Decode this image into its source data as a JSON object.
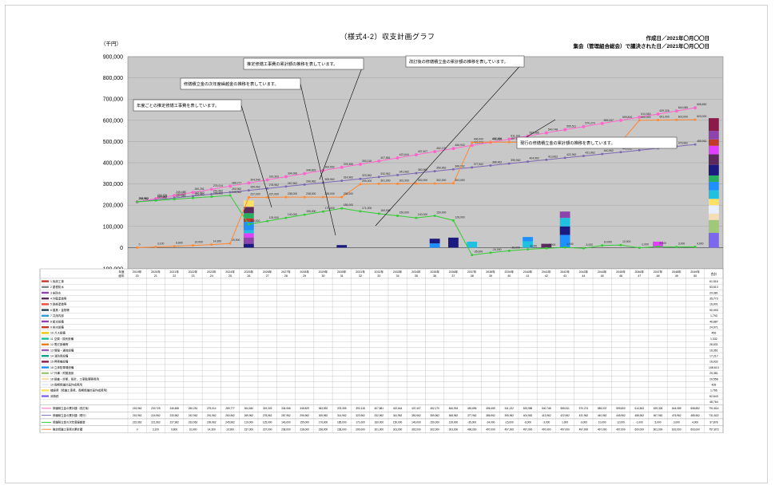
{
  "header": {
    "title": "（様式4-2）収支計画グラフ",
    "created": "作成日／2021年〇月〇〇日",
    "approved": "集会（管理組合総会）で議決された日／2021年〇月〇〇日",
    "unit": "（千円）"
  },
  "chart_data": {
    "type": "bar",
    "title": "（様式4-2）収支計画グラフ",
    "ylabel": "（千円）",
    "ylim": [
      -100000,
      900000
    ],
    "yticks": [
      "900,000",
      "800,000",
      "700,000",
      "600,000",
      "500,000",
      "400,000",
      "300,000",
      "200,000",
      "100,000",
      "0",
      "-100,000"
    ],
    "grid": true,
    "categories": [
      "1",
      "2",
      "3",
      "4",
      "5",
      "6",
      "7",
      "8",
      "9",
      "10",
      "11",
      "12",
      "13",
      "14",
      "15",
      "16",
      "17",
      "18",
      "19",
      "20",
      "21",
      "22",
      "23",
      "24",
      "25",
      "26",
      "27",
      "28",
      "29",
      "30",
      "31"
    ],
    "row_header": [
      "年度",
      "経年"
    ],
    "year_labels": [
      "2019年",
      "2020年",
      "2021年",
      "2022年",
      "2023年",
      "2024年",
      "2025年",
      "2026年",
      "2027年",
      "2028年",
      "2029年",
      "2030年",
      "2031年",
      "2032年",
      "2033年",
      "2034年",
      "2035年",
      "2036年",
      "2037年",
      "2038年",
      "2039年",
      "2040年",
      "2041年",
      "2042年",
      "2043年",
      "2044年",
      "2045年",
      "2046年",
      "2047年",
      "2048年",
      "2049年"
    ],
    "age_labels": [
      "20",
      "21",
      "22",
      "23",
      "24",
      "25",
      "26",
      "27",
      "28",
      "29",
      "30",
      "31",
      "32",
      "33",
      "34",
      "35",
      "36",
      "37",
      "38",
      "39",
      "40",
      "41",
      "42",
      "43",
      "44",
      "45",
      "46",
      "47",
      "48",
      "49",
      "50"
    ],
    "total_label": "合計",
    "series": [
      {
        "name": "改訂後の修繕積立金の累計額",
        "color": "#ff66cc",
        "values": [
          215962,
          230725,
          245488,
          260251,
          275014,
          289777,
          304540,
          319303,
          334066,
          348829,
          363592,
          378355,
          393118,
          407881,
          422644,
          437407,
          452170,
          466933,
          481696,
          496459,
          511222,
          525985,
          540748,
          555511,
          570274,
          585037,
          599800,
          614563,
          629326,
          644089,
          658852
        ]
      },
      {
        "name": "現行の修繕積立金の累計額",
        "color": "#7b68b0",
        "values": [
          215962,
          224962,
          233962,
          242962,
          251962,
          260962,
          269962,
          278962,
          287962,
          296962,
          305962,
          314962,
          323962,
          332962,
          341962,
          350962,
          359962,
          368962,
          377962,
          386962,
          395962,
          404962,
          413962,
          422962,
          431962,
          440962,
          449962,
          458962,
          467962,
          476962,
          485962
        ]
      },
      {
        "name": "修繕積立金の次年度繰越金の推移",
        "color": "#33cc33",
        "values": [
          215962,
          221962,
          227962,
          233962,
          239962,
          245962,
          110000,
          125000,
          140000,
          155000,
          170000,
          185000,
          171000,
          160000,
          150000,
          140000,
          150000,
          128000,
          -35000,
          -24000,
          -15000,
          -8000,
          -3000,
          1000,
          -3000,
          10000,
          12000,
          -1000,
          5000,
          3000,
          4000
        ]
      },
      {
        "name": "推定修繕工事費の累計額",
        "color": "#ff8833",
        "values": [
          0,
          3100,
          6800,
          10000,
          14300,
          19900,
          237000,
          237000,
          238000,
          238000,
          238000,
          238000,
          299000,
          301000,
          301000,
          302000,
          302000,
          303000,
          496000,
          497000,
          497000,
          497000,
          497000,
          497000,
          497000,
          497000,
          497000,
          600000,
          601000,
          602000,
          603000
        ]
      },
      {
        "name": "年度ごとの推定修繕工事費",
        "color": "#1f6fcc",
        "values": [
          0,
          0,
          0,
          0,
          0,
          0,
          222000,
          0,
          0,
          0,
          0,
          0,
          42000,
          47000,
          0,
          0,
          50000,
          0,
          170000,
          0,
          0,
          0,
          0,
          28000,
          0,
          0,
          0,
          75000,
          0,
          0,
          0
        ]
      }
    ],
    "bar_stacks": [
      [],
      [],
      [],
      [],
      [],
      [],
      [
        {
          "v": 18000,
          "c": "#1a1a80"
        },
        {
          "v": 30000,
          "c": "#8e44ad"
        },
        {
          "v": 20000,
          "c": "#e040fb"
        },
        {
          "v": 14000,
          "c": "#20c0e0"
        },
        {
          "v": 40000,
          "c": "#1e90ff"
        },
        {
          "v": 16000,
          "c": "#c0392b"
        },
        {
          "v": 24000,
          "c": "#27ae60"
        },
        {
          "v": 30000,
          "c": "#5c2a5c"
        },
        {
          "v": 30000,
          "c": "#ffe066"
        }
      ],
      [],
      [],
      [],
      [],
      [
        {
          "v": 12000,
          "c": "#1a1a80"
        }
      ],
      [],
      [],
      [],
      [],
      [
        {
          "v": 20000,
          "c": "#1e90ff"
        },
        {
          "v": 22000,
          "c": "#1a1a80"
        }
      ],
      [
        {
          "v": 47000,
          "c": "#1a1a80"
        }
      ],
      [
        {
          "v": 28000,
          "c": "#20c0e0"
        }
      ],
      [],
      [],
      [
        {
          "v": 30000,
          "c": "#20c0e0"
        },
        {
          "v": 20000,
          "c": "#1e90ff"
        }
      ],
      [
        {
          "v": 18000,
          "c": "#5c2a5c"
        }
      ],
      [
        {
          "v": 60000,
          "c": "#1e90ff"
        },
        {
          "v": 40000,
          "c": "#1a1a80"
        },
        {
          "v": 40000,
          "c": "#20c0e0"
        },
        {
          "v": 30000,
          "c": "#8e44ad"
        }
      ],
      [],
      [],
      [],
      [],
      [
        {
          "v": 28000,
          "c": "#e040fb"
        }
      ],
      [],
      [],
      []
    ],
    "total_stack": [
      {
        "v": 70000,
        "c": "#7b68ee"
      },
      {
        "v": 60000,
        "c": "#a0c878"
      },
      {
        "v": 30000,
        "c": "#f5deb3"
      },
      {
        "v": 40000,
        "c": "#e8f0ff"
      },
      {
        "v": 30000,
        "c": "#ffe066"
      },
      {
        "v": 40000,
        "c": "#20c0e0"
      },
      {
        "v": 40000,
        "c": "#1e90ff"
      },
      {
        "v": 30000,
        "c": "#27ae60"
      },
      {
        "v": 50000,
        "c": "#1a1a80"
      },
      {
        "v": 50000,
        "c": "#5c2a5c"
      },
      {
        "v": 40000,
        "c": "#e040fb"
      },
      {
        "v": 30000,
        "c": "#c0392b"
      },
      {
        "v": 40000,
        "c": "#8e44ad"
      },
      {
        "v": 60000,
        "c": "#8b1a4a"
      }
    ],
    "annotations": [
      "推定修繕工事費の累計額の推移を表しています。",
      "改訂後の修繕積立金の累計額の推移を表しています。",
      "修繕積立金の次年度繰越金の推移を表しています。",
      "年度ごとの推定修繕工事費を表しています。",
      "現行の修繕積立金の累計額の推移を表しています。"
    ]
  },
  "table": {
    "rows": [
      {
        "label": "1 仮設工事",
        "color": "#c0392b",
        "total": "61,516"
      },
      {
        "label": "2 屋根防水",
        "color": "#7f8c8d",
        "total": "53,513"
      },
      {
        "label": "3 床防水",
        "color": "#8e44ad",
        "total": "29,381"
      },
      {
        "label": "4 外壁塗装等",
        "color": "#5c2a5c",
        "total": "35,773"
      },
      {
        "label": "5 鉄部塗装等",
        "color": "#e74c3c",
        "total": "16,901"
      },
      {
        "label": "6 建具・金物等",
        "color": "#2c3e50",
        "total": "90,993"
      },
      {
        "label": "7 共用内部",
        "color": "#3498db",
        "total": "1,793"
      },
      {
        "label": "8 給水設備",
        "color": "#8e44ad",
        "total": "46,887"
      },
      {
        "label": "9 排水設備",
        "color": "#c0392b",
        "total": "24,971"
      },
      {
        "label": "10 ガス設備",
        "color": "#f1c40f",
        "total": "456"
      },
      {
        "label": "11 空調・換気設備",
        "color": "#1abc9c",
        "total": "1,332"
      },
      {
        "label": "12 電灯設備等",
        "color": "#e67e22",
        "total": "28,631"
      },
      {
        "label": "13 情報・通信設備",
        "color": "#9b59b6",
        "total": "16,361"
      },
      {
        "label": "14 消防用設備",
        "color": "#16a085",
        "total": "17,217"
      },
      {
        "label": "15 昇降機設備",
        "color": "#8b1a4a",
        "total": "16,932"
      },
      {
        "label": "16 立体駐車場設備",
        "color": "#1e90ff",
        "total": "108,613"
      },
      {
        "label": "17 外構・附属施設",
        "color": "#a0c878",
        "total": "29,381"
      },
      {
        "label": "18 調査・診断、設計、工事監理等費用",
        "color": "#f5deb3",
        "total": "29,558"
      },
      {
        "label": "19 長期修繕計画作成費用",
        "color": "#e8f0ff",
        "total": "428"
      },
      {
        "label": "諸経費（修繕工事費、長期修繕計画作成費用）",
        "color": "#ffe066",
        "total": "1,766"
      },
      {
        "label": "消費税",
        "color": "#7b68ee",
        "total": "62,643"
      },
      {
        "label": "",
        "color": "#ffffff",
        "total": "48,764"
      }
    ],
    "summary_rows": [
      {
        "label": "修繕積立金の累計額（改訂後）",
        "color": "#ff66cc",
        "total": "791,814"
      },
      {
        "label": "修繕積立金の累計額（現行）",
        "color": "#7b68b0",
        "total": "731,822"
      },
      {
        "label": "修繕積立金の次年度繰越金",
        "color": "#33cc33",
        "total": "37,878"
      },
      {
        "label": "推定修繕工事費の累計額",
        "color": "#ff8833",
        "total": "757,873"
      }
    ]
  }
}
